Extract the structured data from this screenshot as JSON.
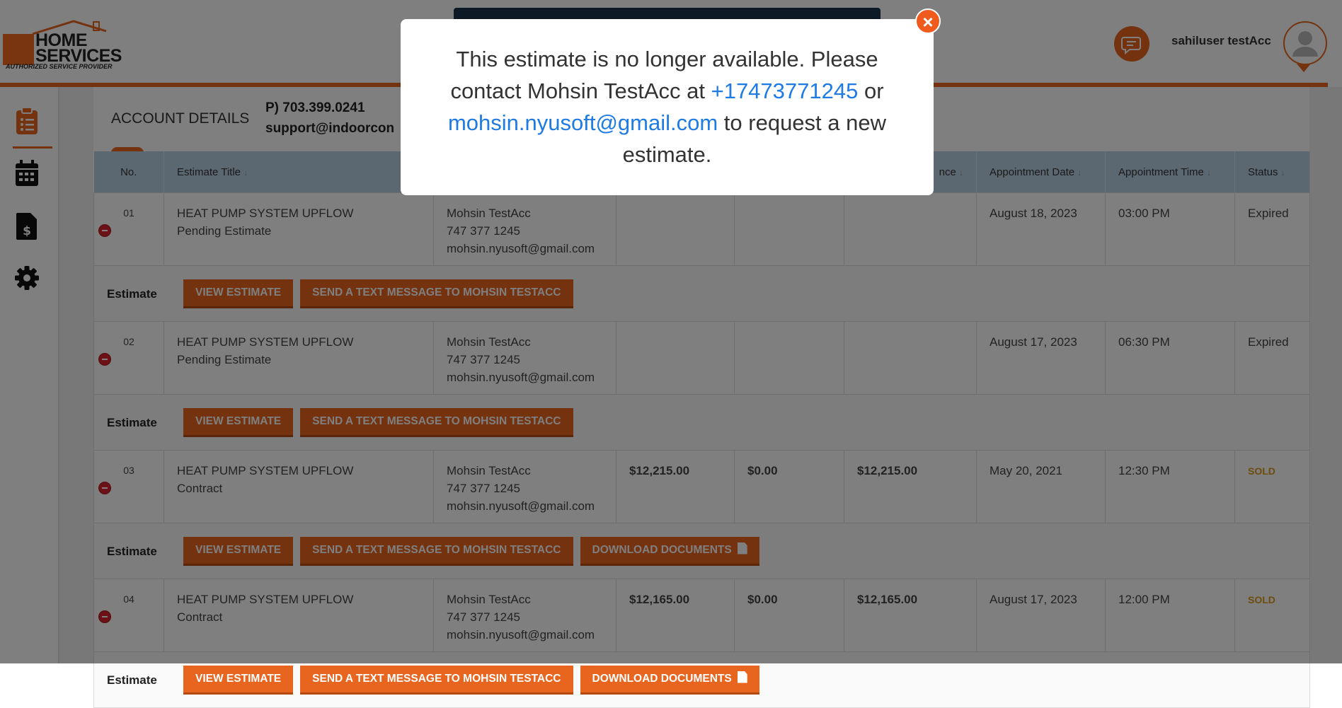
{
  "logo": {
    "line1": "HOME",
    "line2": "SERVICES",
    "tagline": "AUTHORIZED SERVICE PROVIDER"
  },
  "header": {
    "username": "sahiluser testAcc"
  },
  "sidebar": {
    "items": [
      {
        "icon": "clipboard-list-icon"
      },
      {
        "icon": "calendar-icon"
      },
      {
        "icon": "invoice-dollar-icon"
      },
      {
        "icon": "gear-icon"
      }
    ]
  },
  "account": {
    "title": "ACCOUNT DETAILS",
    "phone": "P) 703.399.0241",
    "email": "support@indoorcon"
  },
  "table": {
    "headers": {
      "no": "No.",
      "title": "Estimate Title",
      "balance": "nce",
      "appt_date": "Appointment Date",
      "appt_time": "Appointment Time",
      "status": "Status"
    },
    "action_label": "Estimate",
    "buttons": {
      "view": "VIEW ESTIMATE",
      "text": "SEND A TEXT MESSAGE TO MOHSIN TESTACC",
      "download": "DOWNLOAD DOCUMENTS"
    },
    "rows": [
      {
        "no": "01",
        "title": "HEAT PUMP SYSTEM UPFLOW",
        "subtitle": "Pending Estimate",
        "contact": "Mohsin TestAcc",
        "phone": "747 377 1245",
        "email": "mohsin.nyusoft@gmail.com",
        "total": "",
        "paid": "",
        "balance": "",
        "date": "August 18, 2023",
        "time": "03:00 PM",
        "status": "Expired"
      },
      {
        "no": "02",
        "title": "HEAT PUMP SYSTEM UPFLOW",
        "subtitle": "Pending Estimate",
        "contact": "Mohsin TestAcc",
        "phone": "747 377 1245",
        "email": "mohsin.nyusoft@gmail.com",
        "total": "",
        "paid": "",
        "balance": "",
        "date": "August 17, 2023",
        "time": "06:30 PM",
        "status": "Expired"
      },
      {
        "no": "03",
        "title": "HEAT PUMP SYSTEM UPFLOW",
        "subtitle": "Contract",
        "contact": "Mohsin TestAcc",
        "phone": "747 377 1245",
        "email": "mohsin.nyusoft@gmail.com",
        "total": "$12,215.00",
        "paid": "$0.00",
        "balance": "$12,215.00",
        "date": "May 20, 2021",
        "time": "12:30 PM",
        "status": "SOLD"
      },
      {
        "no": "04",
        "title": "HEAT PUMP SYSTEM UPFLOW",
        "subtitle": "Contract",
        "contact": "Mohsin TestAcc",
        "phone": "747 377 1245",
        "email": "mohsin.nyusoft@gmail.com",
        "total": "$12,165.00",
        "paid": "$0.00",
        "balance": "$12,165.00",
        "date": "August 17, 2023",
        "time": "12:00 PM",
        "status": "SOLD"
      }
    ]
  },
  "modal": {
    "text_before": "This estimate is no longer available. Please contact Mohsin TestAcc at ",
    "phone_link": "+17473771245",
    "text_middle": " or ",
    "email_link": "mohsin.nyusoft@gmail.com",
    "text_after": " to request a new estimate."
  },
  "colors": {
    "accent": "#e8651f",
    "header_blue": "#b9d1e3",
    "link": "#1e7be4",
    "sold": "#d99a1c"
  }
}
